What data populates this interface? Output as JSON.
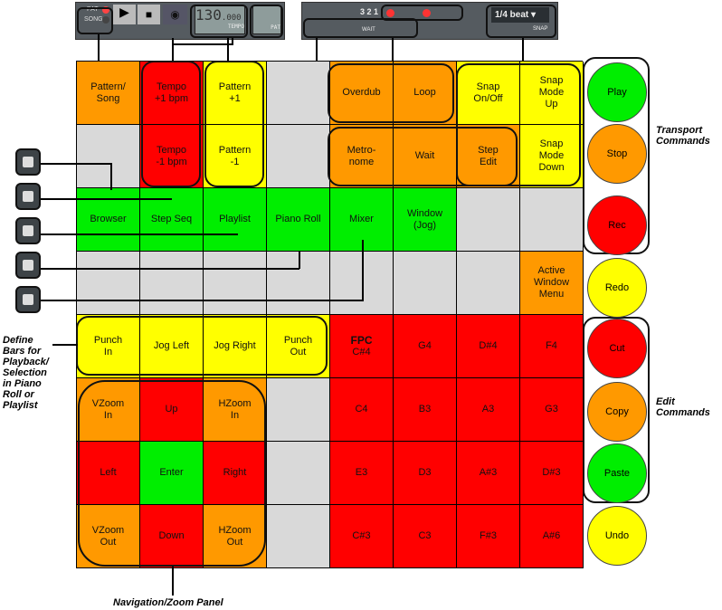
{
  "toolbar": {
    "pat": "PAT",
    "song": "SONG",
    "tempo": "130",
    "tempo_dec": ".000",
    "tempo_label": "TEMPO",
    "pat_label": "PAT",
    "snap_value": "1/4 beat",
    "snap_label": "SNAP",
    "wait_label": "WAIT",
    "count": "3 2 1"
  },
  "grid": [
    [
      [
        "Pattern/\nSong",
        "o"
      ],
      [
        "Tempo\n+1 bpm",
        "r"
      ],
      [
        "Pattern\n+1",
        "y"
      ],
      [
        "",
        "x"
      ],
      [
        "Overdub",
        "o"
      ],
      [
        "Loop",
        "o"
      ],
      [
        "Snap\nOn/Off",
        "y"
      ],
      [
        "Snap\nMode\nUp",
        "y"
      ]
    ],
    [
      [
        "",
        "x"
      ],
      [
        "Tempo\n-1 bpm",
        "r"
      ],
      [
        "Pattern\n-1",
        "y"
      ],
      [
        "",
        "x"
      ],
      [
        "Metro-\nnome",
        "o"
      ],
      [
        "Wait",
        "o"
      ],
      [
        "Step\nEdit",
        "o"
      ],
      [
        "Snap\nMode\nDown",
        "y"
      ]
    ],
    [
      [
        "Browser",
        "g"
      ],
      [
        "Step Seq",
        "g"
      ],
      [
        "Playlist",
        "g"
      ],
      [
        "Piano Roll",
        "g"
      ],
      [
        "Mixer",
        "g"
      ],
      [
        "Window\n(Jog)",
        "g"
      ],
      [
        "",
        "x"
      ],
      [
        "",
        "x"
      ]
    ],
    [
      [
        "",
        "x"
      ],
      [
        "",
        "x"
      ],
      [
        "",
        "x"
      ],
      [
        "",
        "x"
      ],
      [
        "",
        "x"
      ],
      [
        "",
        "x"
      ],
      [
        "",
        "x"
      ],
      [
        "Active\nWindow\nMenu",
        "o"
      ]
    ],
    [
      [
        "Punch\nIn",
        "y"
      ],
      [
        "Jog Left",
        "y"
      ],
      [
        "Jog Right",
        "y"
      ],
      [
        "Punch\nOut",
        "y"
      ],
      [
        "C#4",
        "r",
        "FPC"
      ],
      [
        "G4",
        "r"
      ],
      [
        "D#4",
        "r"
      ],
      [
        "F4",
        "r"
      ]
    ],
    [
      [
        "VZoom\nIn",
        "o"
      ],
      [
        "Up",
        "r"
      ],
      [
        "HZoom\nIn",
        "o"
      ],
      [
        "",
        "x"
      ],
      [
        "C4",
        "r"
      ],
      [
        "B3",
        "r"
      ],
      [
        "A3",
        "r"
      ],
      [
        "G3",
        "r"
      ]
    ],
    [
      [
        "Left",
        "r"
      ],
      [
        "Enter",
        "g"
      ],
      [
        "Right",
        "r"
      ],
      [
        "",
        "x"
      ],
      [
        "E3",
        "r"
      ],
      [
        "D3",
        "r"
      ],
      [
        "A#3",
        "r"
      ],
      [
        "D#3",
        "r"
      ]
    ],
    [
      [
        "VZoom\nOut",
        "o"
      ],
      [
        "Down",
        "r"
      ],
      [
        "HZoom\nOut",
        "o"
      ],
      [
        "",
        "x"
      ],
      [
        "C#3",
        "r"
      ],
      [
        "C3",
        "r"
      ],
      [
        "F#3",
        "r"
      ],
      [
        "A#6",
        "r"
      ]
    ]
  ],
  "colors": {
    "o": "#ff9900",
    "r": "#ff0000",
    "y": "#ffff00",
    "g": "#00ee00",
    "x": "#d9d9d9"
  },
  "buttons": [
    [
      "Play",
      "g"
    ],
    [
      "Stop",
      "o"
    ],
    [
      "Rec",
      "r"
    ],
    [
      "Redo",
      "y"
    ],
    [
      "Cut",
      "r"
    ],
    [
      "Copy",
      "o"
    ],
    [
      "Paste",
      "g"
    ],
    [
      "Undo",
      "y"
    ]
  ],
  "labels": {
    "transport": "Transport\nCommands",
    "edit": "Edit\nCommands",
    "define": "Define\nBars for\nPlayback/\nSelection\nin Piano\nRoll or\nPlaylist",
    "nav": "Navigation/Zoom Panel"
  }
}
